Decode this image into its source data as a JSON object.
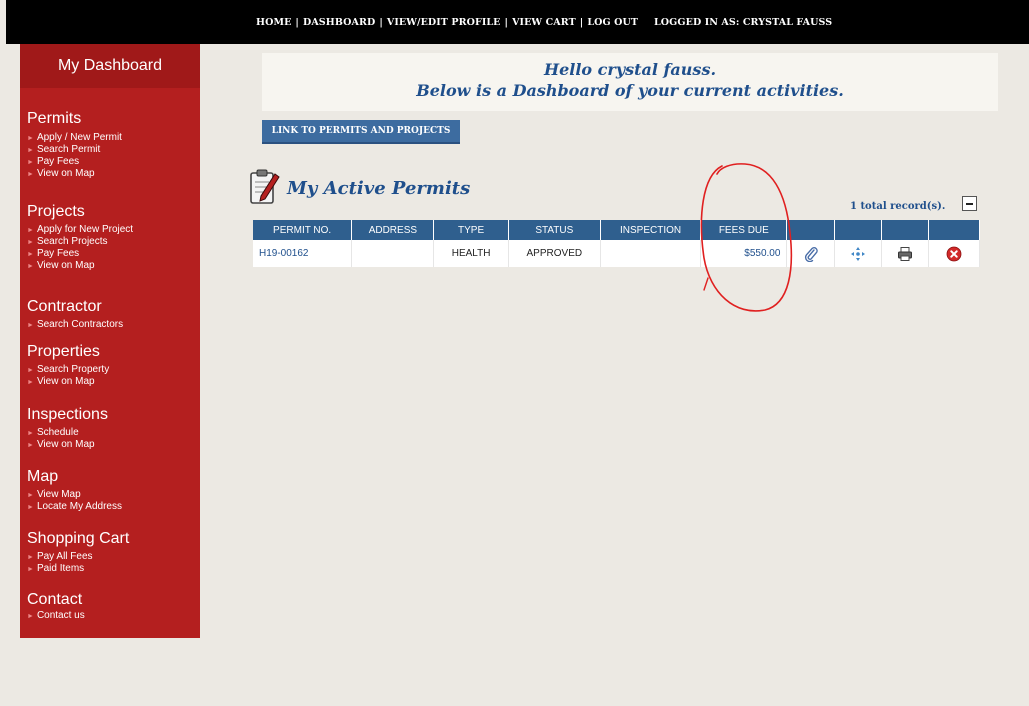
{
  "topnav": {
    "home": "HOME",
    "dashboard": "DASHBOARD",
    "profile": "VIEW/EDIT PROFILE",
    "cart": "VIEW CART",
    "logout": "LOG OUT",
    "separator": "|",
    "logged_in": "LOGGED IN AS:  CRYSTAL FAUSS"
  },
  "sidebar": {
    "title": "My Dashboard",
    "sections": [
      {
        "label": "Permits",
        "items": [
          "Apply / New Permit",
          "Search Permit",
          "Pay Fees",
          "View on Map"
        ]
      },
      {
        "label": "Projects",
        "items": [
          "Apply for New Project",
          "Search Projects",
          "Pay Fees",
          "View on Map"
        ]
      },
      {
        "label": "Contractor",
        "items": [
          "Search Contractors"
        ]
      },
      {
        "label": "Properties",
        "items": [
          "Search Property",
          "View on Map"
        ]
      },
      {
        "label": "Inspections",
        "items": [
          "Schedule",
          "View on Map"
        ]
      },
      {
        "label": "Map",
        "items": [
          "View Map",
          "Locate My Address"
        ]
      },
      {
        "label": "Shopping Cart",
        "items": [
          "Pay All Fees",
          "Paid Items"
        ]
      },
      {
        "label": "Contact",
        "items": [
          "Contact us"
        ]
      }
    ]
  },
  "greeting": {
    "line1": "Hello crystal fauss.",
    "line2": "Below is a Dashboard of your current activities."
  },
  "link_button": "LINK TO PERMITS AND PROJECTS",
  "permits": {
    "title": "My Active Permits",
    "record_count": "1 total record(s).",
    "columns": [
      "PERMIT NO.",
      "ADDRESS",
      "TYPE",
      "STATUS",
      "INSPECTION",
      "FEES DUE"
    ],
    "rows": [
      {
        "permit_no": "H19-00162",
        "address": "",
        "type": "HEALTH",
        "status": "APPROVED",
        "inspection": "",
        "fees_due": "$550.00"
      }
    ],
    "row_icons": [
      "paperclip-icon",
      "move-icon",
      "printer-icon",
      "delete-icon"
    ]
  },
  "colors": {
    "sidebar": "#b41f1f",
    "table_header": "#2f5f8e",
    "accent_text": "#1f4f8c",
    "annotation": "#e02020"
  }
}
